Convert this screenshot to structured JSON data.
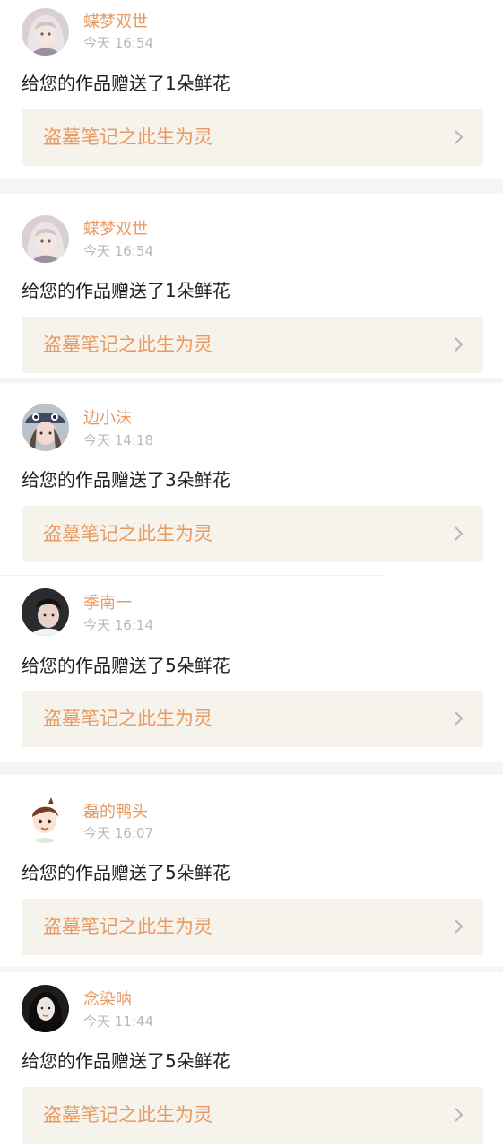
{
  "notifications": [
    {
      "username": "蝶梦双世",
      "time": "今天 16:54",
      "message": "给您的作品赠送了1朵鲜花",
      "work_title": "盗墓笔记之此生为灵",
      "avatar": "anime-girl-avatar"
    },
    {
      "username": "蝶梦双世",
      "time": "今天 16:54",
      "message": "给您的作品赠送了1朵鲜花",
      "work_title": "盗墓笔记之此生为灵",
      "avatar": "anime-girl-avatar"
    },
    {
      "username": "边小沫",
      "time": "今天 14:18",
      "message": "给您的作品赠送了3朵鲜花",
      "work_title": "盗墓笔记之此生为灵",
      "avatar": "girl-hat-avatar"
    },
    {
      "username": "季南一",
      "time": "今天 16:14",
      "message": "给您的作品赠送了5朵鲜花",
      "work_title": "盗墓笔记之此生为灵",
      "avatar": "boy-portrait-avatar"
    },
    {
      "username": "磊的鸭头",
      "time": "今天 16:07",
      "message": "给您的作品赠送了5朵鲜花",
      "work_title": "盗墓笔记之此生为灵",
      "avatar": "cartoon-boy-avatar"
    },
    {
      "username": "念染呐",
      "time": "今天 11:44",
      "message": "给您的作品赠送了5朵鲜花",
      "work_title": "盗墓笔记之此生为灵",
      "avatar": "dark-hair-girl-avatar"
    }
  ],
  "colors": {
    "accent": "#e89a63",
    "time_gray": "#b9b9b9",
    "message_text": "#222222",
    "work_box_bg": "#f5f3ec",
    "separator": "#f5f5f5"
  },
  "icons": {
    "link_arrow": "chevron-right-icon"
  }
}
